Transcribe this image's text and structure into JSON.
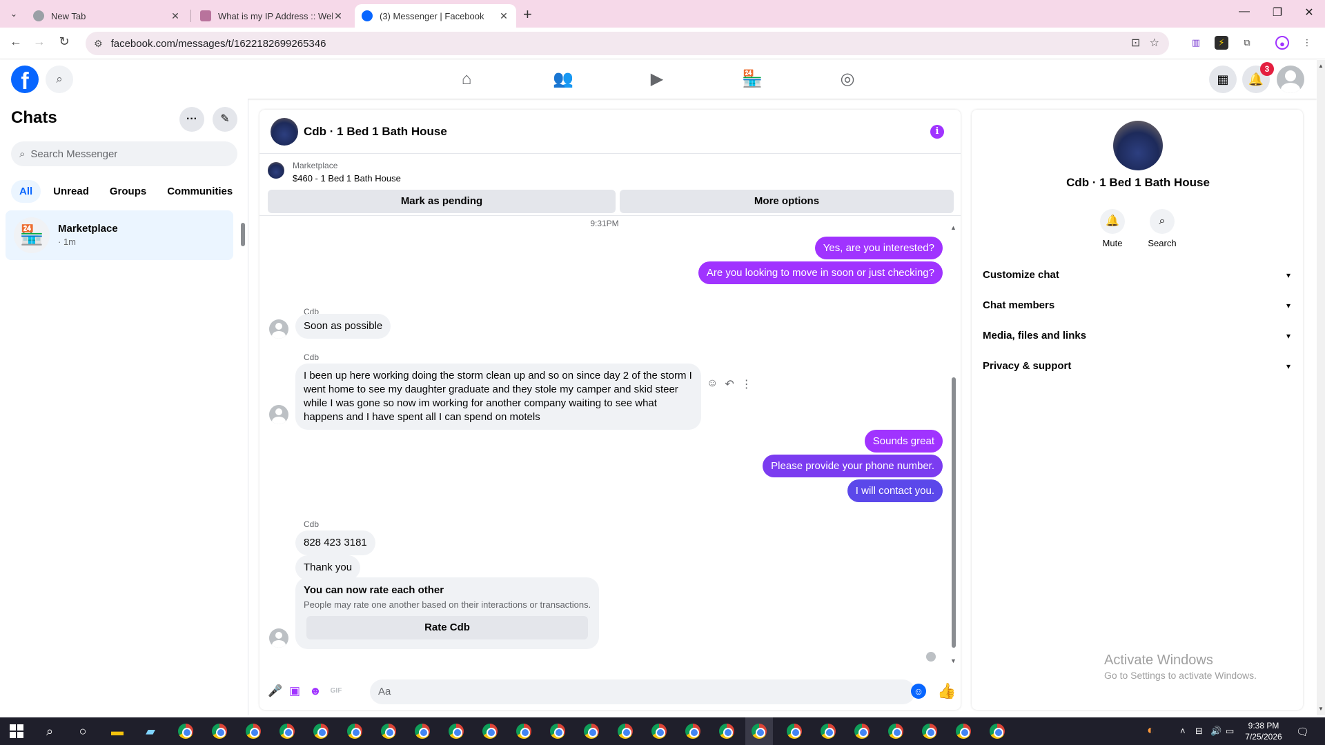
{
  "browser": {
    "tabs": [
      {
        "title": "New Tab",
        "active": false
      },
      {
        "title": "What is my IP Address :: WebBr",
        "active": false
      },
      {
        "title": "(3) Messenger | Facebook",
        "active": true
      }
    ],
    "url": "facebook.com/messages/t/1622182699265346"
  },
  "fb_nav": {
    "notification_count": "3",
    "nav_icons": [
      "home-icon",
      "friends-icon",
      "video-icon",
      "marketplace-icon",
      "groups-icon"
    ]
  },
  "sidebar": {
    "title": "Chats",
    "search_placeholder": "Search Messenger",
    "filters": [
      "All",
      "Unread",
      "Groups",
      "Communities"
    ],
    "active_filter": "All",
    "chats": [
      {
        "name": "Marketplace",
        "time": "· 1m"
      }
    ]
  },
  "conversation": {
    "title": "Cdb · 1 Bed 1 Bath House",
    "marketplace_label": "Marketplace",
    "listing": "$460 - 1 Bed 1 Bath House",
    "mark_pending": "Mark as pending",
    "more_options": "More options",
    "timestamp": "9:31PM",
    "sender": "Cdb",
    "messages": {
      "out1": "Yes, are you interested?",
      "out2": "Are you looking to move in soon or just checking?",
      "in1": "Soon as possible",
      "in2": "I been up here working doing the storm clean up and so on since day 2 of the storm I went home to see my daughter graduate and they stole my camper and skid steer while I was gone so now im working for another company waiting to see what happens and I have spent all I can spend on motels",
      "out3": "Sounds great",
      "out4": "Please provide your phone number.",
      "out5": "I will contact you.",
      "in3": "828 423 3181",
      "in4": "Thank you"
    },
    "rating": {
      "title": "You can now rate each other",
      "desc": "People may rate one another based on their interactions or transactions.",
      "button": "Rate Cdb"
    },
    "composer_placeholder": "Aa",
    "accent_color": "#a033ff"
  },
  "details": {
    "name": "Cdb · 1 Bed 1 Bath House",
    "mute": "Mute",
    "search": "Search",
    "sections": [
      "Customize chat",
      "Chat members",
      "Media, files and links",
      "Privacy & support"
    ]
  },
  "watermark": {
    "line1": "Activate Windows",
    "line2": "Go to Settings to activate Windows."
  },
  "taskbar": {
    "time": "9:38 PM",
    "date": "7/25/2026"
  }
}
